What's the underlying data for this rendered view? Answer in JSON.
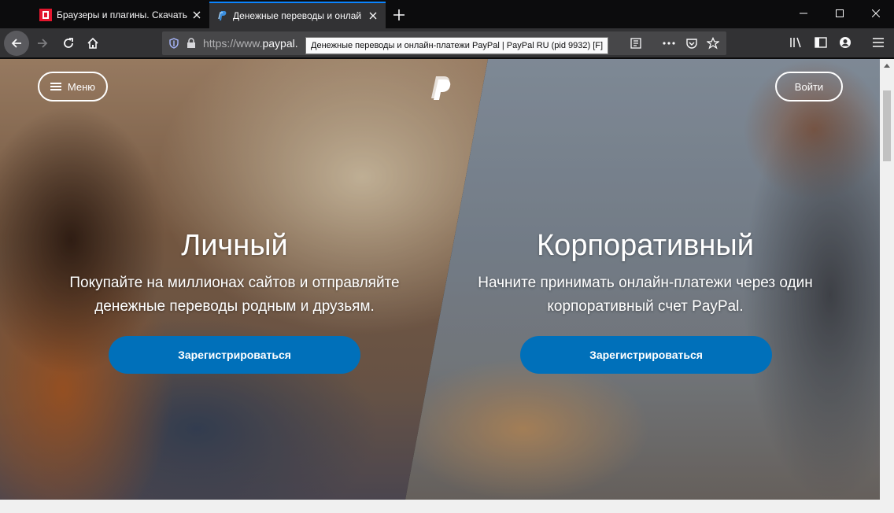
{
  "browser": {
    "tabs": [
      {
        "title": "Браузеры и плагины. Скачать",
        "active": false
      },
      {
        "title": "Денежные переводы и онлай",
        "active": true
      }
    ],
    "url_prefix": "https://www.",
    "url_domain": "paypal.",
    "tooltip": "Денежные переводы и онлайн-платежи PayPal | PayPal RU (pid 9932) [F]"
  },
  "header": {
    "menu_label": "Меню",
    "login_label": "Войти"
  },
  "personal": {
    "title": "Личный",
    "line1": "Покупайте на миллионах сайтов и отправляйте",
    "line2": "денежные переводы родным и друзьям.",
    "cta": "Зарегистрироваться"
  },
  "business": {
    "title": "Корпоративный",
    "line1": "Начните принимать онлайн-платежи через один",
    "line2": "корпоративный счет PayPal.",
    "cta": "Зарегистрироваться"
  },
  "colors": {
    "accent": "#0070ba",
    "tab_highlight": "#0a84ff",
    "toolbar": "#323234"
  }
}
